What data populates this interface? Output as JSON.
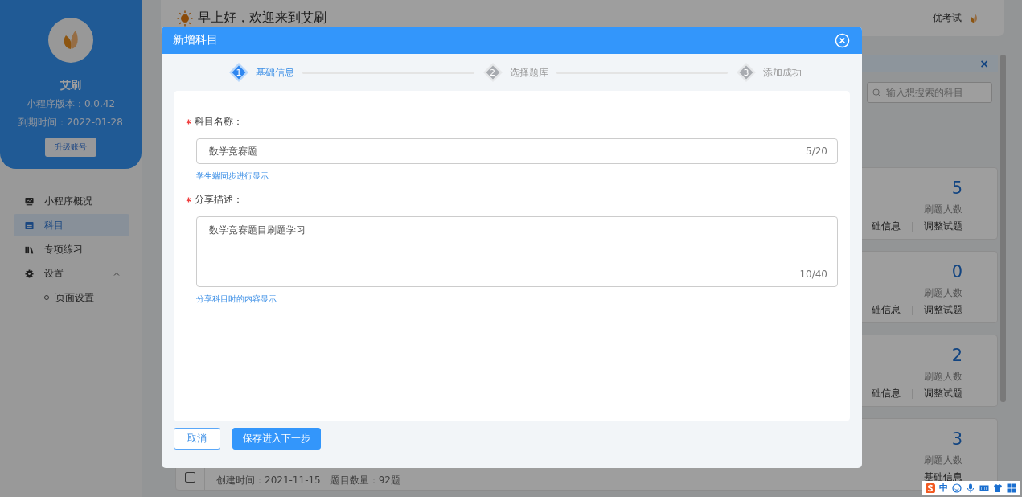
{
  "sidebar": {
    "app_name": "艾刷",
    "version": "小程序版本：0.0.42",
    "expiry": "到期时间：2022-01-28",
    "upgrade_button": "升级账号",
    "items": [
      {
        "label": "小程序概况",
        "kind": "chart",
        "selected": false
      },
      {
        "label": "科目",
        "kind": "list",
        "selected": true
      },
      {
        "label": "专项练习",
        "kind": "books",
        "selected": false
      },
      {
        "label": "设置",
        "kind": "gear",
        "selected": false,
        "expanded": true,
        "children": [
          {
            "label": "页面设置",
            "selected": false
          }
        ]
      }
    ]
  },
  "header": {
    "greeting": "早上好，欢迎来到艾刷",
    "user_name": "优考试"
  },
  "notice_bar": {
    "close": "×"
  },
  "search": {
    "placeholder": "输入想搜索的科目"
  },
  "subjects": [
    {
      "count": "5",
      "count_label": "刷题人数",
      "actions": [
        "础信息",
        "调整试题"
      ]
    },
    {
      "count": "0",
      "count_label": "刷题人数",
      "actions": [
        "础信息",
        "调整试题"
      ]
    },
    {
      "count": "2",
      "count_label": "刷题人数",
      "actions": [
        "础信息",
        "调整试题"
      ]
    },
    {
      "checked": false,
      "meta": "创建时间：2021-11-15　题目数量：92题",
      "count": "3",
      "count_label": "刷题人数",
      "actions": [
        "基础信息"
      ]
    }
  ],
  "modal": {
    "title": "新增科目",
    "steps": [
      {
        "number": "1",
        "label": "基础信息",
        "selected": true
      },
      {
        "number": "2",
        "label": "选择题库",
        "selected": false
      },
      {
        "number": "3",
        "label": "添加成功",
        "selected": false
      }
    ],
    "fields": [
      {
        "kind": "input",
        "label": "科目名称：",
        "required": true,
        "value": "数学竞赛题",
        "counter": "5/20",
        "hint": "学生端同步进行显示"
      },
      {
        "kind": "textarea",
        "label": "分享描述：",
        "required": true,
        "value": "数学竞赛题目刷题学习",
        "counter": "10/40",
        "hint": "分享科目时的内容显示"
      }
    ],
    "buttons": [
      {
        "label": "取消",
        "kind": "secondary"
      },
      {
        "label": "保存进入下一步",
        "kind": "primary"
      }
    ]
  },
  "ime_toolbar": {
    "label": "中"
  }
}
